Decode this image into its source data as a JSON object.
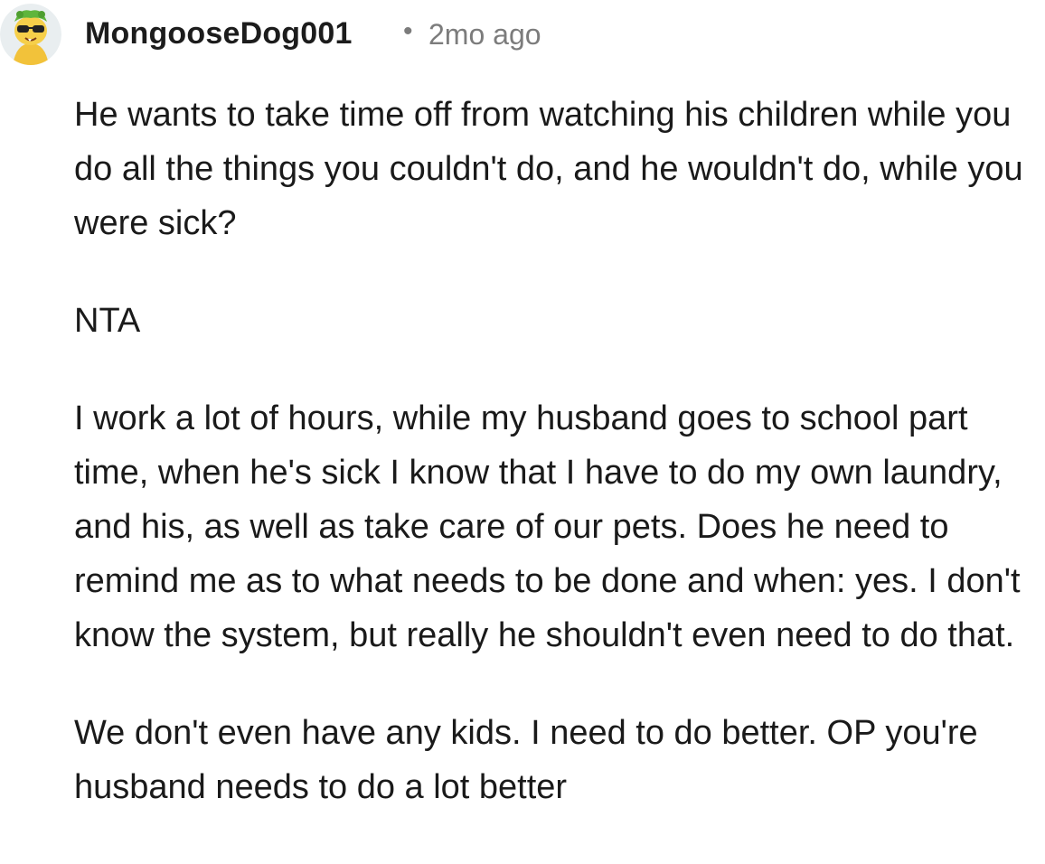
{
  "comment": {
    "author": "MongooseDog001",
    "separator": "•",
    "timestamp": "2mo ago",
    "avatar_icon": "cartoon-avatar-icon",
    "paragraphs": [
      "He wants to take time off from watching his children while you do all the things you couldn't do, and he wouldn't do, while you were sick?",
      "NTA",
      "I work a lot of hours, while my husband goes to school part time, when he's sick I know that I have to do my own laundry, and his, as well as take care of our pets. Does he need to remind me as to what needs to be done and when: yes. I don't know the system, but really he shouldn't even need to do that.",
      "We don't even have any kids. I need to do better. OP you're husband needs to do a lot better"
    ]
  }
}
